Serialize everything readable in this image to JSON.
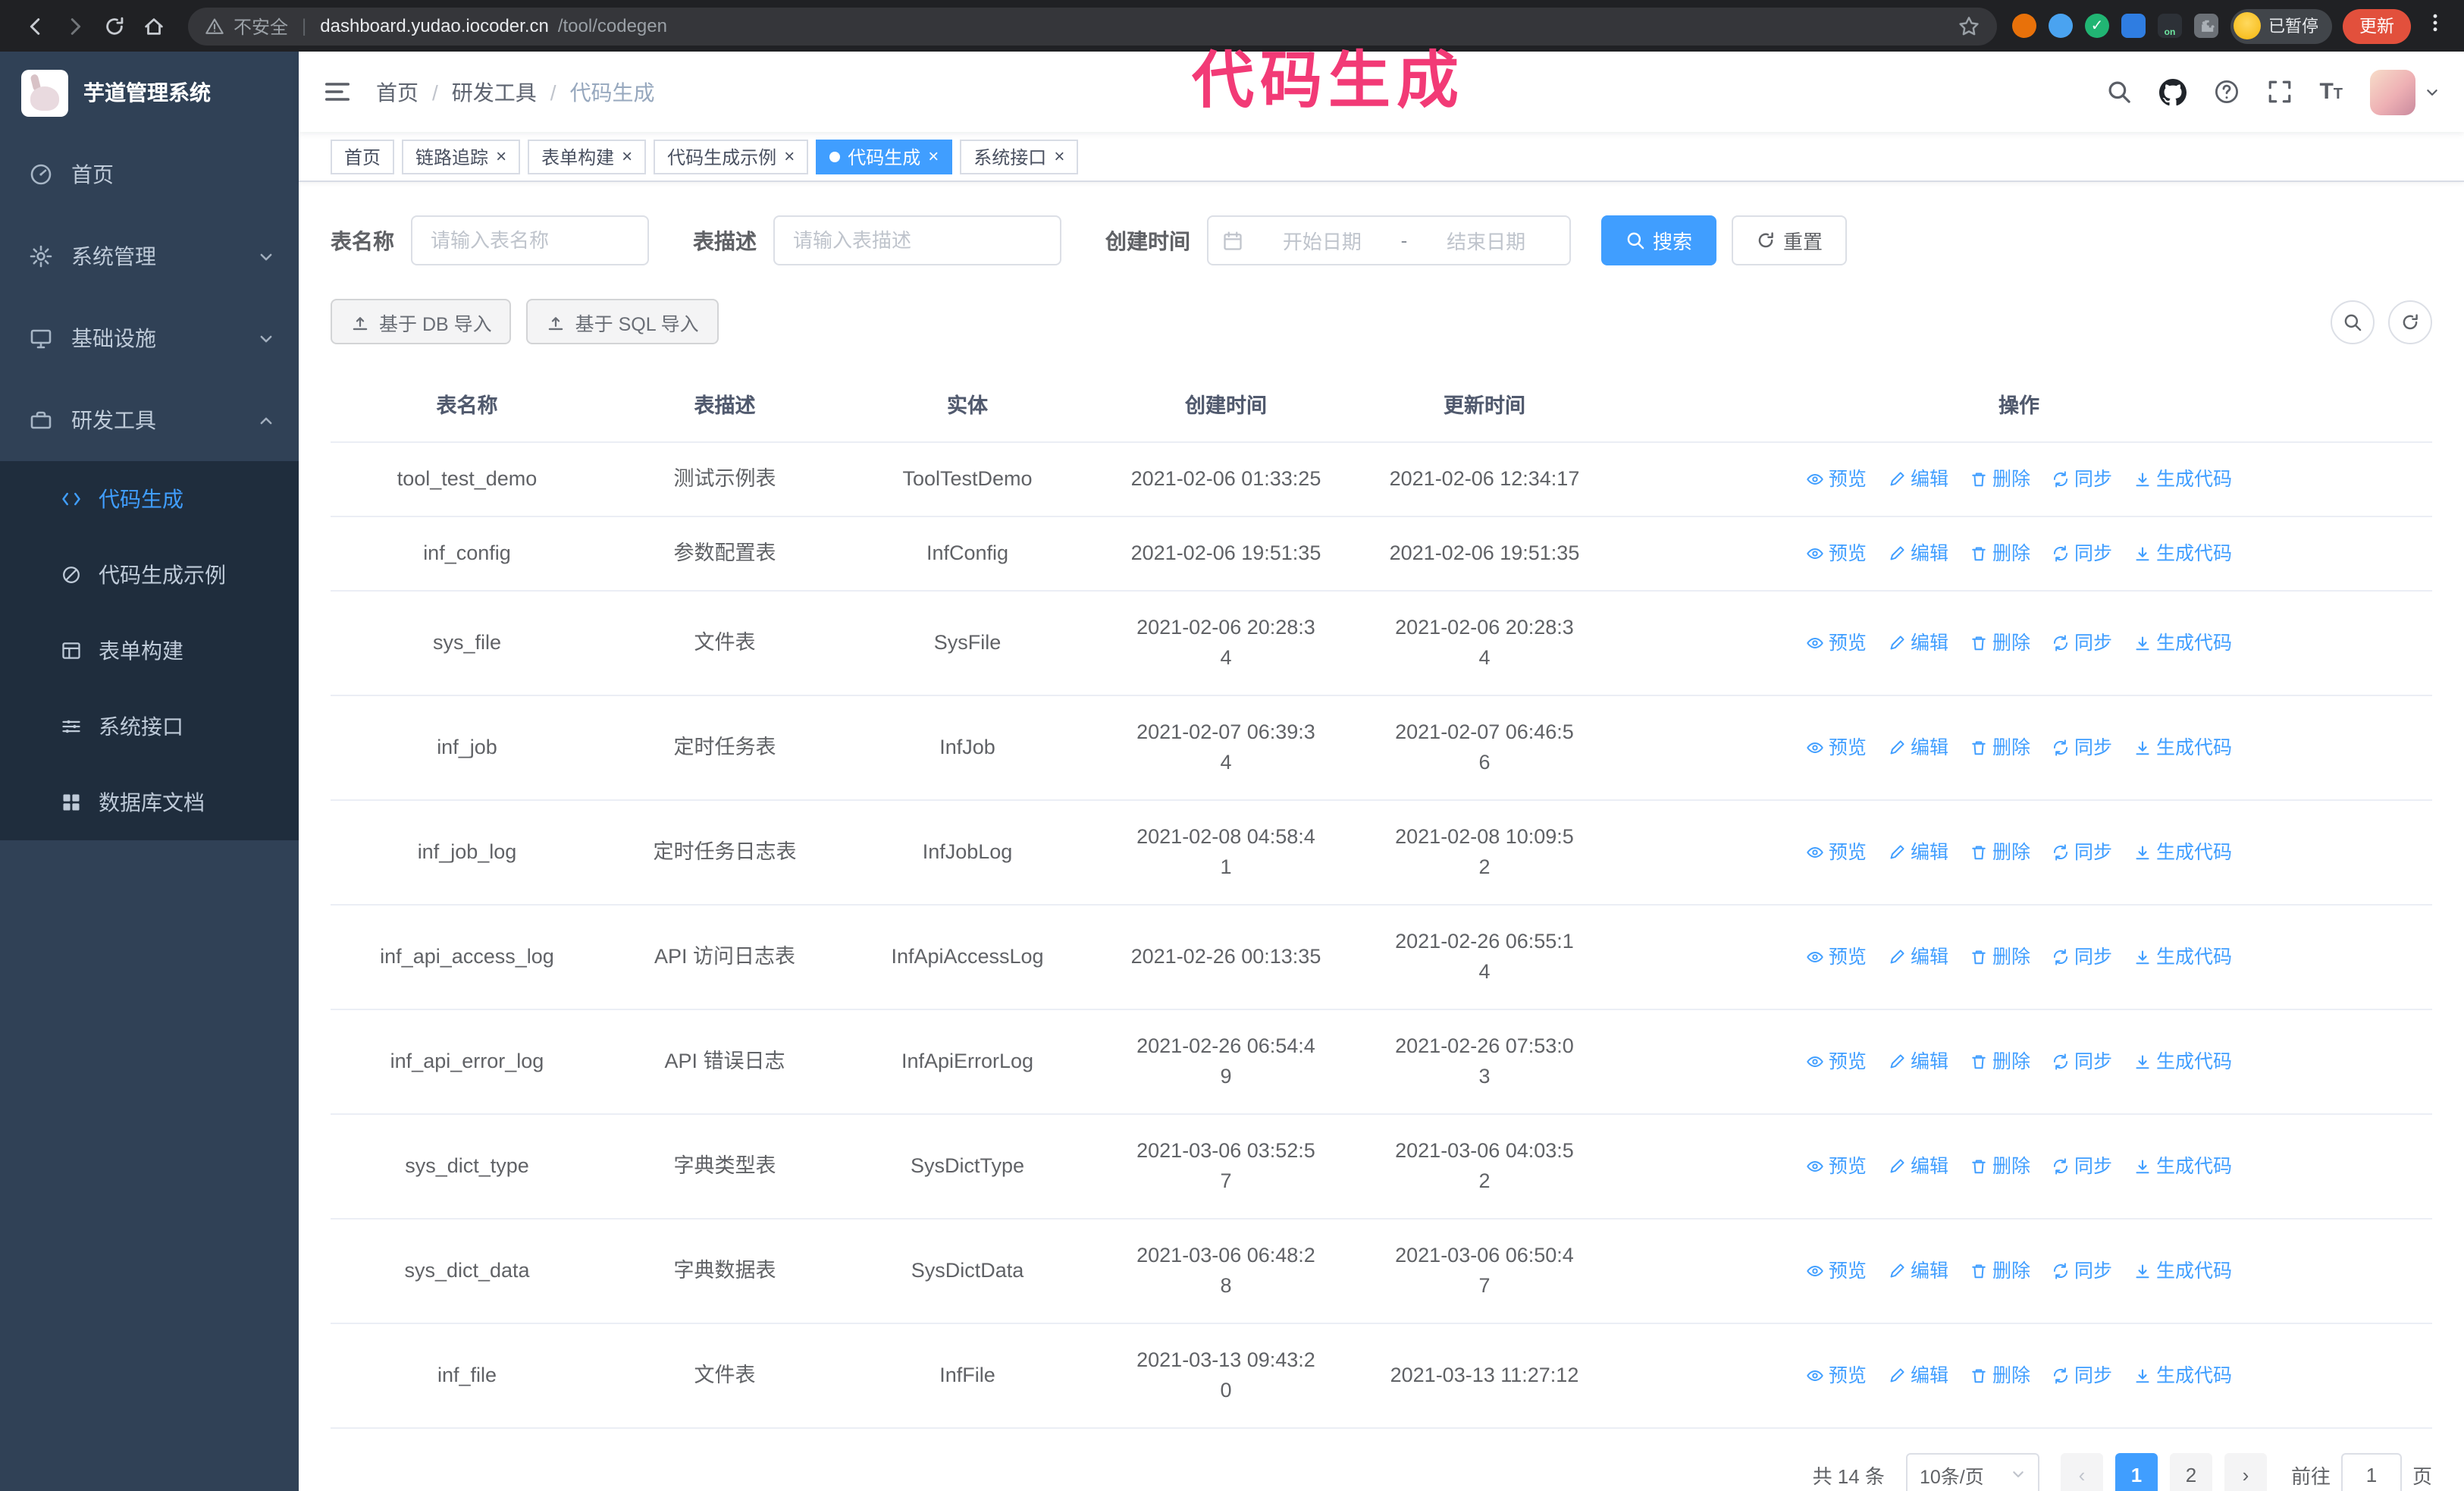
{
  "colors": {
    "primary": "#409EFF",
    "annotation_pink": "#F23A76",
    "sidebar_bg": "#304156",
    "sidebar_submenu_bg": "#1F2D3D",
    "browser_bar_bg": "#202124",
    "update_button_bg": "#E2503C",
    "table_border": "#EBEEF5"
  },
  "annotation": {
    "text": "代码生成"
  },
  "browser": {
    "security_label": "不安全",
    "url_host": "dashboard.yudao.iocoder.cn",
    "url_path": "/tool/codegen",
    "profile_badge": "已暂停",
    "update_button": "更新",
    "icons": [
      "back-icon",
      "forward-icon",
      "reload-icon",
      "home-icon",
      "warning-icon",
      "star-icon",
      "extension-icons",
      "more-menu-icon"
    ]
  },
  "sidebar": {
    "app_title": "芋道管理系统",
    "items": [
      {
        "label": "首页",
        "icon": "dashboard"
      },
      {
        "label": "系统管理",
        "icon": "gear",
        "chevron": "down"
      },
      {
        "label": "基础设施",
        "icon": "monitor",
        "chevron": "down"
      },
      {
        "label": "研发工具",
        "icon": "tools",
        "chevron": "up"
      }
    ],
    "subitems": [
      {
        "label": "代码生成",
        "icon": "code",
        "active": true
      },
      {
        "label": "代码生成示例",
        "icon": "example"
      },
      {
        "label": "表单构建",
        "icon": "form"
      },
      {
        "label": "系统接口",
        "icon": "api"
      },
      {
        "label": "数据库文档",
        "icon": "db-doc"
      }
    ]
  },
  "navbar": {
    "breadcrumb": [
      "首页",
      "研发工具",
      "代码生成"
    ],
    "icons": [
      "search-icon",
      "github-icon",
      "question-icon",
      "fullscreen-icon",
      "text-size-icon",
      "avatar",
      "caret-down-icon"
    ]
  },
  "tags": [
    {
      "label": "首页",
      "closable": false,
      "active": false
    },
    {
      "label": "链路追踪",
      "closable": true,
      "active": false
    },
    {
      "label": "表单构建",
      "closable": true,
      "active": false
    },
    {
      "label": "代码生成示例",
      "closable": true,
      "active": false
    },
    {
      "label": "代码生成",
      "closable": true,
      "active": true
    },
    {
      "label": "系统接口",
      "closable": true,
      "active": false
    }
  ],
  "filters": {
    "table_name_label": "表名称",
    "table_name_placeholder": "请输入表名称",
    "table_desc_label": "表描述",
    "table_desc_placeholder": "请输入表描述",
    "create_time_label": "创建时间",
    "date_start_placeholder": "开始日期",
    "date_separator": "-",
    "date_end_placeholder": "结束日期",
    "search_button": "搜索",
    "reset_button": "重置"
  },
  "toolbar": {
    "import_db_button": "基于 DB 导入",
    "import_sql_button": "基于 SQL 导入"
  },
  "table": {
    "columns": [
      "表名称",
      "表描述",
      "实体",
      "创建时间",
      "更新时间",
      "操作"
    ],
    "actions": [
      {
        "label": "预览",
        "icon": "eye",
        "name": "preview"
      },
      {
        "label": "编辑",
        "icon": "edit",
        "name": "edit"
      },
      {
        "label": "删除",
        "icon": "trash",
        "name": "delete"
      },
      {
        "label": "同步",
        "icon": "sync",
        "name": "sync"
      },
      {
        "label": "生成代码",
        "icon": "download",
        "name": "generate-code"
      }
    ],
    "rows": [
      {
        "name": "tool_test_demo",
        "desc": "测试示例表",
        "entity": "ToolTestDemo",
        "created": "2021-02-06 01:33:25",
        "updated": "2021-02-06 12:34:17"
      },
      {
        "name": "inf_config",
        "desc": "参数配置表",
        "entity": "InfConfig",
        "created": "2021-02-06 19:51:35",
        "updated": "2021-02-06 19:51:35"
      },
      {
        "name": "sys_file",
        "desc": "文件表",
        "entity": "SysFile",
        "created": "2021-02-06 20:28:3\n4",
        "updated": "2021-02-06 20:28:3\n4"
      },
      {
        "name": "inf_job",
        "desc": "定时任务表",
        "entity": "InfJob",
        "created": "2021-02-07 06:39:3\n4",
        "updated": "2021-02-07 06:46:5\n6"
      },
      {
        "name": "inf_job_log",
        "desc": "定时任务日志表",
        "entity": "InfJobLog",
        "created": "2021-02-08 04:58:4\n1",
        "updated": "2021-02-08 10:09:5\n2"
      },
      {
        "name": "inf_api_access_log",
        "desc": "API 访问日志表",
        "entity": "InfApiAccessLog",
        "created": "2021-02-26 00:13:35",
        "updated": "2021-02-26 06:55:1\n4"
      },
      {
        "name": "inf_api_error_log",
        "desc": "API 错误日志",
        "entity": "InfApiErrorLog",
        "created": "2021-02-26 06:54:4\n9",
        "updated": "2021-02-26 07:53:0\n3"
      },
      {
        "name": "sys_dict_type",
        "desc": "字典类型表",
        "entity": "SysDictType",
        "created": "2021-03-06 03:52:5\n7",
        "updated": "2021-03-06 04:03:5\n2"
      },
      {
        "name": "sys_dict_data",
        "desc": "字典数据表",
        "entity": "SysDictData",
        "created": "2021-03-06 06:48:2\n8",
        "updated": "2021-03-06 06:50:4\n7"
      },
      {
        "name": "inf_file",
        "desc": "文件表",
        "entity": "InfFile",
        "created": "2021-03-13 09:43:2\n0",
        "updated": "2021-03-13 11:27:12"
      }
    ]
  },
  "pagination": {
    "total_text": "共 14 条",
    "page_size": "10条/页",
    "prev_label": "‹",
    "next_label": "›",
    "pages": [
      "1",
      "2"
    ],
    "active_page": "1",
    "goto_label": "前往",
    "goto_value": "1",
    "page_unit": "页"
  }
}
